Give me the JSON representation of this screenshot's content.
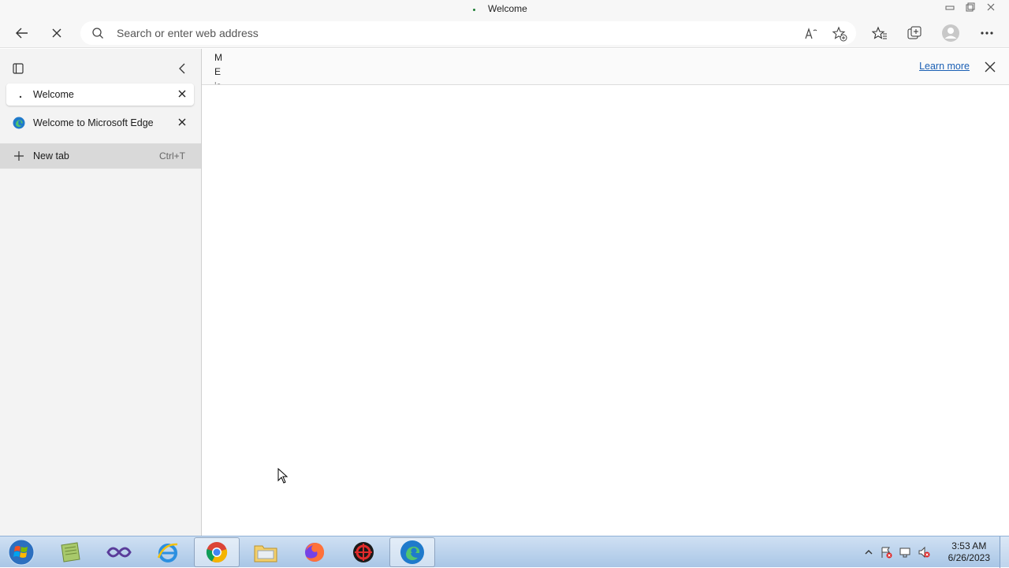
{
  "window": {
    "title": "Welcome",
    "controls": [
      "minimize",
      "restore",
      "close"
    ]
  },
  "toolbar": {
    "back_icon": "back-arrow-icon",
    "stop_icon": "stop-loading-icon",
    "address_placeholder": "Search or enter web address",
    "address_value": "",
    "right_icons": [
      "read-aloud-icon",
      "add-favorite-icon",
      "favorites-icon",
      "collections-icon",
      "profile-icon",
      "more-icon"
    ]
  },
  "sidebar": {
    "tabs": [
      {
        "label": "Welcome",
        "active": true,
        "favicon": "loading-dot-icon"
      },
      {
        "label": "Welcome to Microsoft Edge",
        "active": false,
        "favicon": "edge-icon"
      }
    ],
    "new_tab": {
      "label": "New tab",
      "shortcut": "Ctrl+T"
    }
  },
  "infobar": {
    "message_lines": [
      "M",
      "E",
      "is"
    ],
    "learn_more": "Learn more"
  },
  "taskbar": {
    "apps": [
      "explorer-notes-icon",
      "visual-studio-icon",
      "internet-explorer-icon",
      "chrome-icon",
      "file-explorer-icon",
      "firefox-icon",
      "security-app-icon",
      "edge-icon"
    ],
    "pressed": [
      "chrome-icon",
      "edge-icon"
    ],
    "time": "3:53 AM",
    "date": "6/26/2023"
  },
  "colors": {
    "accent": "#1a5fb4",
    "taskbar_top": "#cfe0f3",
    "taskbar_bottom": "#a9c6e6",
    "sidebar_bg": "#f3f3f3",
    "new_tab_highlight": "#d9d9d9"
  }
}
